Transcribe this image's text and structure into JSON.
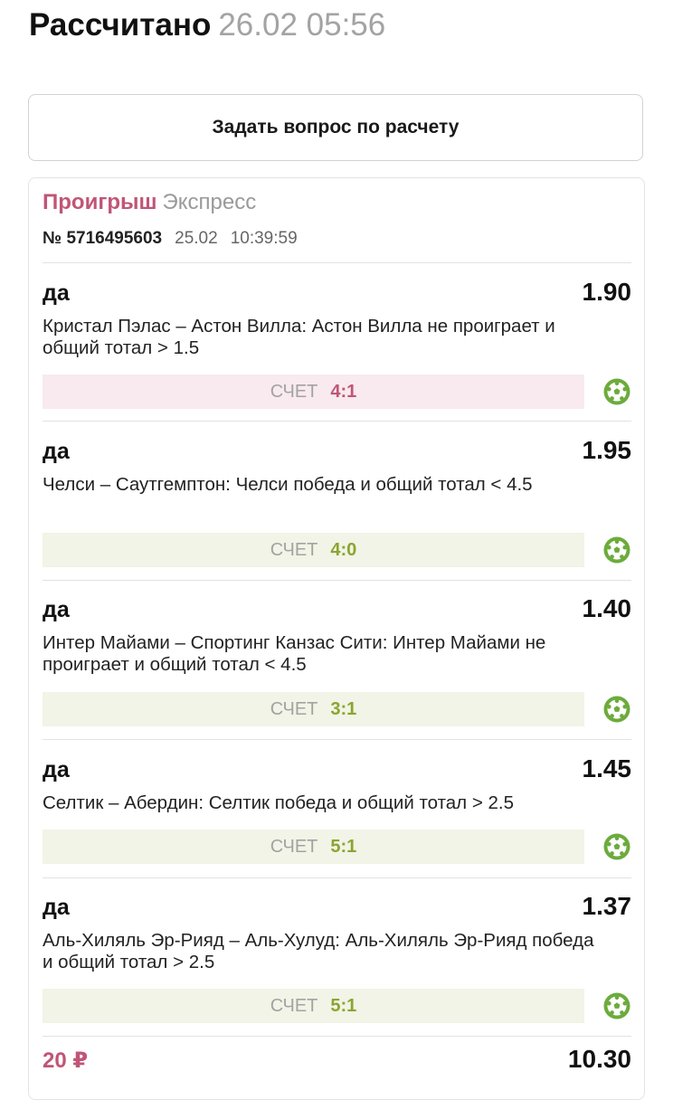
{
  "header": {
    "title": "Рассчитано",
    "datetime": "26.02 05:56"
  },
  "ask_button_label": "Задать вопрос по расчету",
  "card": {
    "status": "Проигрыш",
    "type": "Экспресс",
    "number": "№ 5716495603",
    "date": "25.02",
    "time": "10:39:59",
    "bets": [
      {
        "answer": "да",
        "odd": "1.90",
        "description": "Кристал Пэлас – Астон Вилла: Астон Вилла не проиграет и общий тотал > 1.5",
        "score_label": "СЧЕТ",
        "score": "4:1",
        "result": "lose"
      },
      {
        "answer": "да",
        "odd": "1.95",
        "description": "Челси – Саутгемптон: Челси победа и общий тотал < 4.5",
        "score_label": "СЧЕТ",
        "score": "4:0",
        "result": "win"
      },
      {
        "answer": "да",
        "odd": "1.40",
        "description": "Интер Майами – Спортинг Канзас Сити: Интер Майами не проиграет и общий тотал < 4.5",
        "score_label": "СЧЕТ",
        "score": "3:1",
        "result": "win"
      },
      {
        "answer": "да",
        "odd": "1.45",
        "description": "Селтик – Абердин: Селтик победа и общий тотал > 2.5",
        "score_label": "СЧЕТ",
        "score": "5:1",
        "result": "win"
      },
      {
        "answer": "да",
        "odd": "1.37",
        "description": "Аль-Хиляль Эр-Рияд – Аль-Хулуд: Аль-Хиляль Эр-Рияд победа и общий тотал > 2.5",
        "score_label": "СЧЕТ",
        "score": "5:1",
        "result": "win"
      }
    ],
    "stake": "20 ₽",
    "total_odd": "10.30"
  },
  "colors": {
    "loss": "#c05577",
    "win": "#8aa530",
    "ball": "#6cab3c"
  },
  "icons": {
    "sport": "soccer-ball-icon"
  }
}
